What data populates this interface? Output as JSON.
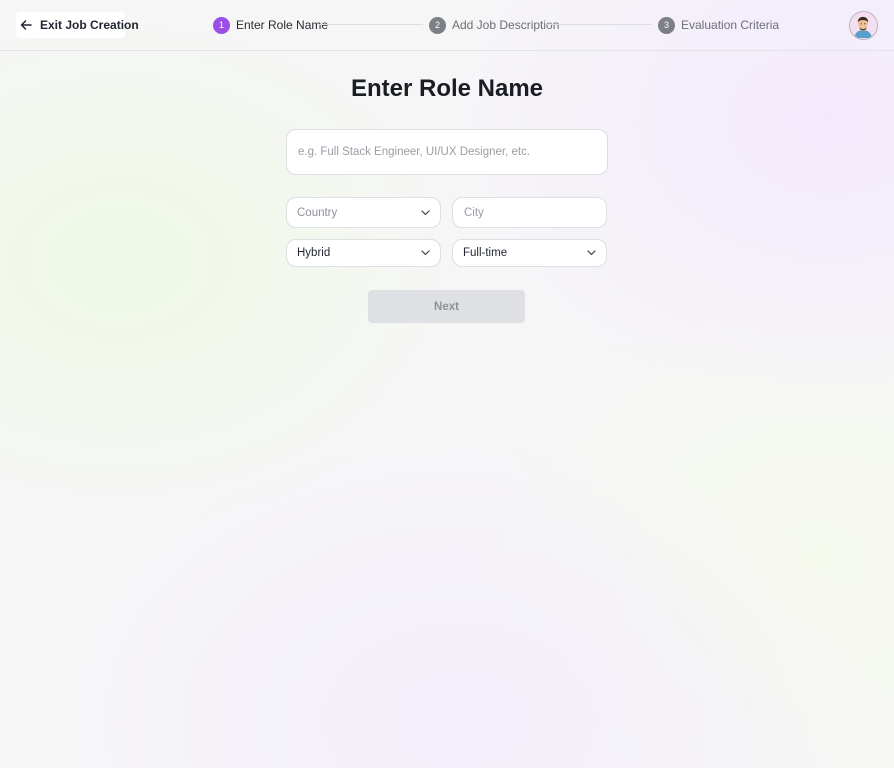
{
  "header": {
    "exit_label": "Exit Job Creation",
    "steps": [
      {
        "number": "1",
        "label": "Enter Role Name",
        "active": true
      },
      {
        "number": "2",
        "label": "Add Job Description",
        "active": false
      },
      {
        "number": "3",
        "label": "Evaluation Criteria",
        "active": false
      }
    ]
  },
  "main": {
    "title": "Enter Role Name",
    "role_placeholder": "e.g. Full Stack Engineer, UI/UX Designer, etc.",
    "country_placeholder": "Country",
    "city_placeholder": "City",
    "work_mode": "Hybrid",
    "employment_type": "Full-time",
    "next_label": "Next"
  },
  "colors": {
    "accent": "#9b4fe6",
    "inactive_step": "#7c7f86",
    "disabled_button": "#dfe0e3"
  },
  "icons": [
    "arrow-left-icon",
    "chevron-down-icon",
    "avatar"
  ]
}
